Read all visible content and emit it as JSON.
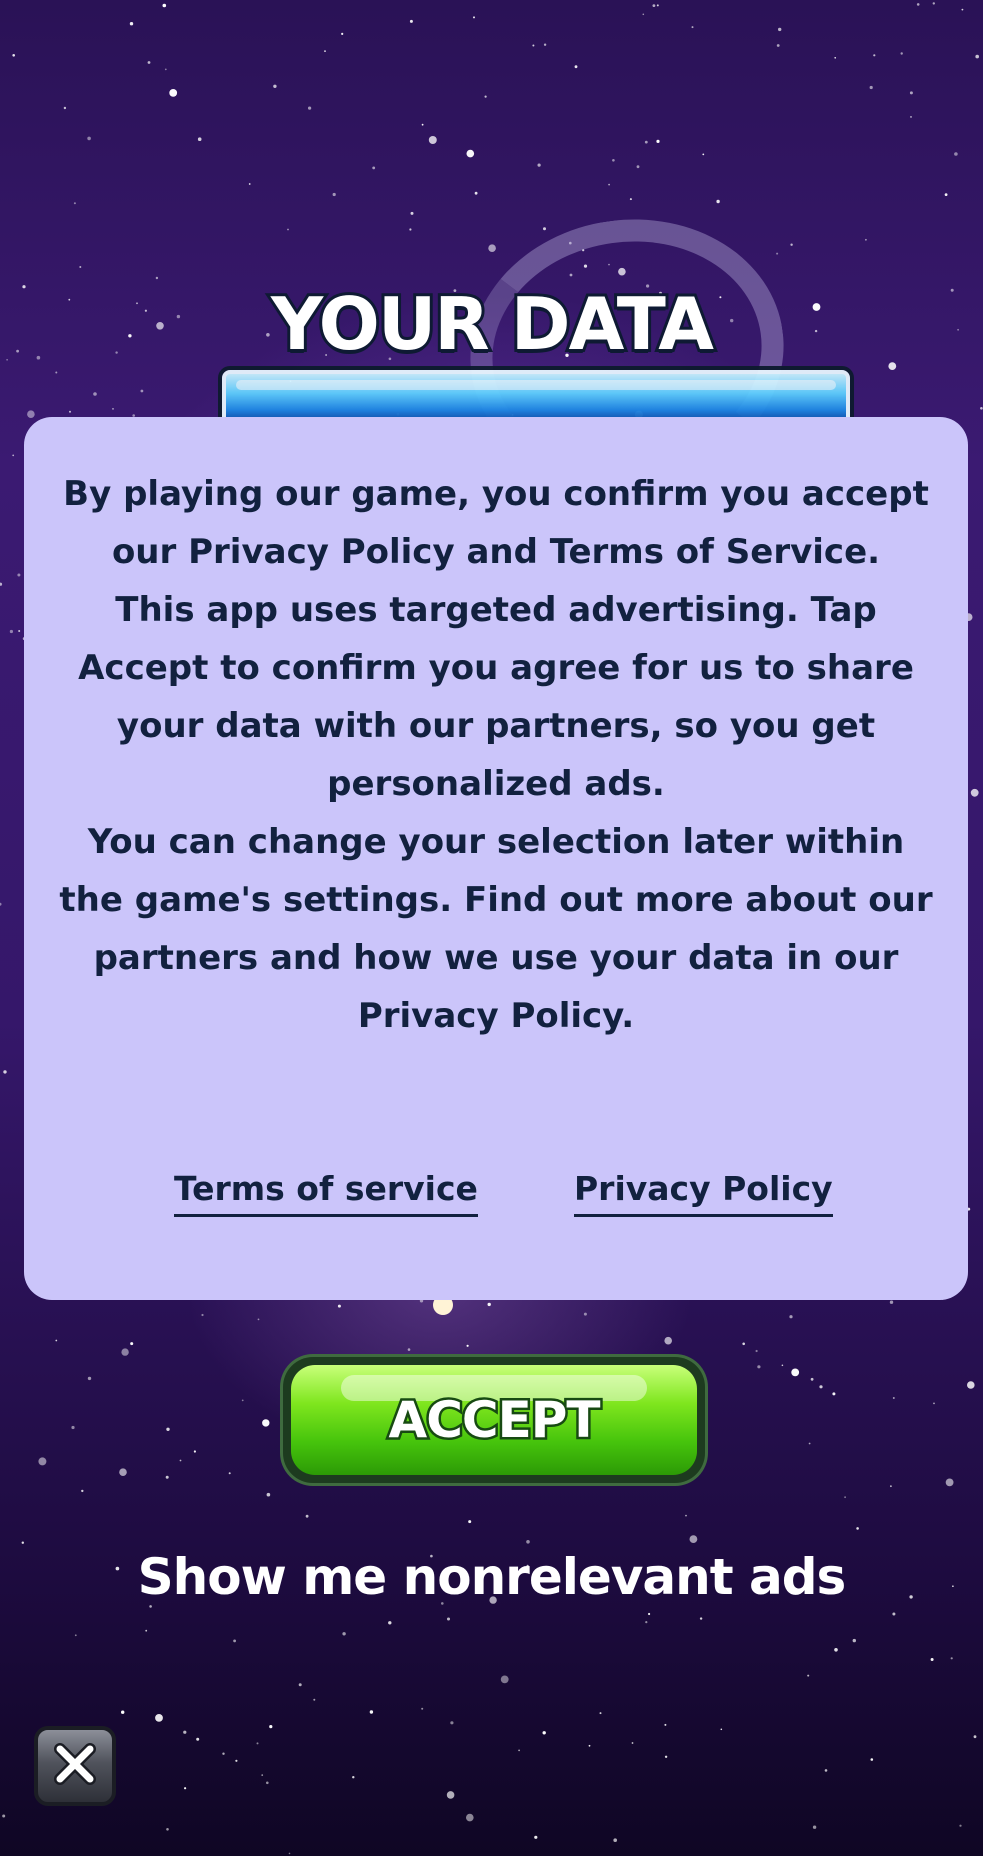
{
  "header": {
    "title": "YOUR DATA"
  },
  "panel": {
    "paragraphs": [
      "By playing our game, you confirm you accept our Privacy Policy and Terms of Service.",
      "This app uses targeted advertising. Tap Accept to confirm you agree for us to share your data with our partners, so you get personalized ads.",
      "You can change your selection later within the game's settings. Find out more about our partners and how we use your data in our Privacy Policy."
    ],
    "links": {
      "terms": "Terms of service",
      "privacy": "Privacy Policy"
    }
  },
  "actions": {
    "accept_label": "ACCEPT",
    "nonrelevant_label": "Show me nonrelevant ads"
  },
  "close": {
    "icon": "close-icon"
  },
  "colors": {
    "panel_bg": "#cbc5fa",
    "text": "#12213f",
    "accept_green": "#46c40c",
    "background": "#35176a"
  }
}
